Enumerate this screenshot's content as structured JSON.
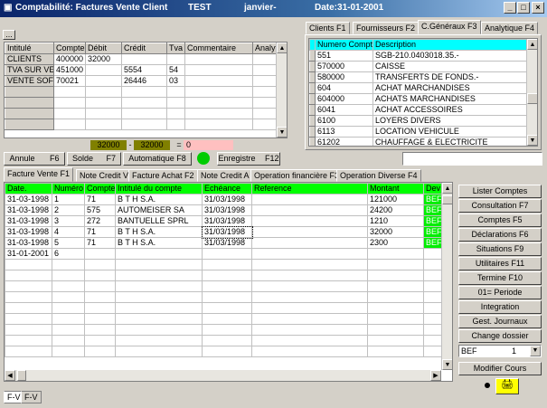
{
  "title": {
    "app": "Comptabilité: Factures Vente Client",
    "mode": "TEST",
    "period": "janvier-",
    "date": "Date:31-01-2001"
  },
  "window_controls": {
    "minimize": "_",
    "maximize": "□",
    "close": "×"
  },
  "top_small_button": "...",
  "left_grid": {
    "headers": [
      "Intitulé",
      "Compte",
      "Débit",
      "Crédit",
      "Tva",
      "Commentaire",
      "Analyt"
    ],
    "rows": [
      [
        "CLIENTS",
        "400000",
        "32000",
        "",
        "",
        "",
        ""
      ],
      [
        "TVA SUR VE",
        "451000",
        "",
        "5554",
        "54",
        "",
        ""
      ],
      [
        "VENTE SOF",
        "70021",
        "",
        "26446",
        "03",
        "",
        ""
      ]
    ]
  },
  "balance": {
    "debit": "32000",
    "minus": "-",
    "credit": "32000",
    "equals": "=",
    "diff": "0"
  },
  "action_buttons": {
    "annule": "Annule",
    "annule_key": "F6",
    "solde": "Solde",
    "solde_key": "F7",
    "automatique": "Automatique F8",
    "enregistre": "Enregistre",
    "enregistre_key": "F12"
  },
  "right_tabs": [
    {
      "label": "Clients",
      "key": "F1"
    },
    {
      "label": "Fournisseurs",
      "key": "F2"
    },
    {
      "label": "C.Généraux",
      "key": "F3"
    },
    {
      "label": "Analytique",
      "key": "F4"
    }
  ],
  "accounts": {
    "headers": [
      "Numero Compte",
      "Description"
    ],
    "rows": [
      [
        "551",
        "SGB-210.0403018.35.-"
      ],
      [
        "570000",
        "CAISSE"
      ],
      [
        "580000",
        "TRANSFERTS DE FONDS.-"
      ],
      [
        "604",
        "ACHAT MARCHANDISES"
      ],
      [
        "604000",
        "ACHATS MARCHANDISES"
      ],
      [
        "6041",
        "ACHAT ACCESSOIRES"
      ],
      [
        "6100",
        "LOYERS DIVERS"
      ],
      [
        "6113",
        "LOCATION VEHICULE"
      ],
      [
        "61202",
        "CHAUFFAGE & ELECTRICITE"
      ]
    ],
    "search_value": ""
  },
  "main_tabs": [
    "Facture Vente F1",
    "Note Credit V",
    "Facture Achat F2",
    "Note Credit A",
    "Operation financière F3",
    "Operation Diverse F4"
  ],
  "main_grid": {
    "headers": [
      "Date.",
      "Numéro",
      "Compte",
      "Intitulé du compte",
      "Echéance",
      "Reference",
      "Montant",
      "Dev"
    ],
    "rows": [
      [
        "31-03-1998",
        "1",
        "71",
        "B T H S.A.",
        "31/03/1998",
        "",
        "121000",
        "BEF"
      ],
      [
        "31-03-1998",
        "2",
        "575",
        "AUTOMEISER SA",
        "31/03/1998",
        "",
        "24200",
        "BEF"
      ],
      [
        "31-03-1998",
        "3",
        "272",
        "BANTUELLE SPRL",
        "31/03/1998",
        "",
        "1210",
        "BEF"
      ],
      [
        "31-03-1998",
        "4",
        "71",
        "B T H S.A.",
        "31/03/1998",
        "",
        "32000",
        "BEF"
      ],
      [
        "31-03-1998",
        "5",
        "71",
        "B T H S.A.",
        "31/03/1998",
        "",
        "2300",
        "BEF"
      ],
      [
        "31-01-2001",
        "6",
        "",
        "",
        "",
        "",
        "",
        ""
      ]
    ]
  },
  "side_buttons": [
    "Lister Comptes",
    "Consultation F7",
    "Comptes     F5",
    "Déclarations F6",
    "Situations   F9",
    "Utilitaires   F11",
    "Termine   F10",
    "01= Periode",
    "Integration",
    "Gest. Journaux",
    "Change dossier"
  ],
  "currency": {
    "code": "BEF",
    "rate": "1"
  },
  "modifier_cours": "Modifier Cours",
  "bottom_tabs": [
    "F-V",
    "F-V"
  ],
  "colors": {
    "green": "#00ff00",
    "cyan": "#00ffff",
    "olive": "#808000",
    "pink": "#ffc0c0",
    "status_dot": "#00cc00"
  }
}
